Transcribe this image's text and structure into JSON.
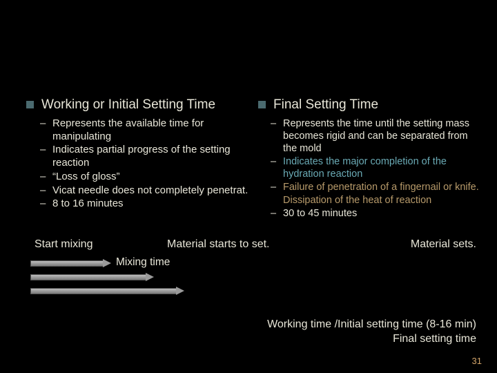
{
  "left": {
    "heading": "Working or Initial Setting Time",
    "items": [
      "Represents the available time for manipulating",
      "Indicates partial progress of the setting reaction",
      "“Loss of gloss”",
      "Vicat needle does not completely penetrat.",
      "8 to 16 minutes"
    ]
  },
  "right": {
    "heading": "Final Setting Time",
    "items": [
      {
        "text": "Represents the time until the setting mass becomes rigid and can be separated from the mold"
      },
      {
        "text": "Indicates the major completion of the hydration reaction",
        "class": "highlight-blue"
      },
      {
        "text": "Failure of penetration of a fingernail or knife. Dissipation of the heat of reaction",
        "class": "highlight-tan"
      },
      {
        "text": "30 to 45 minutes"
      }
    ]
  },
  "midrow": {
    "start": "Start mixing",
    "middle": "Material starts to set.",
    "end": "Material sets."
  },
  "timeline": {
    "mixing_label": "Mixing time"
  },
  "bottom": {
    "line1": "Working time /Initial setting time (8-16 min)",
    "line2": "Final setting time"
  },
  "page_number": "31"
}
